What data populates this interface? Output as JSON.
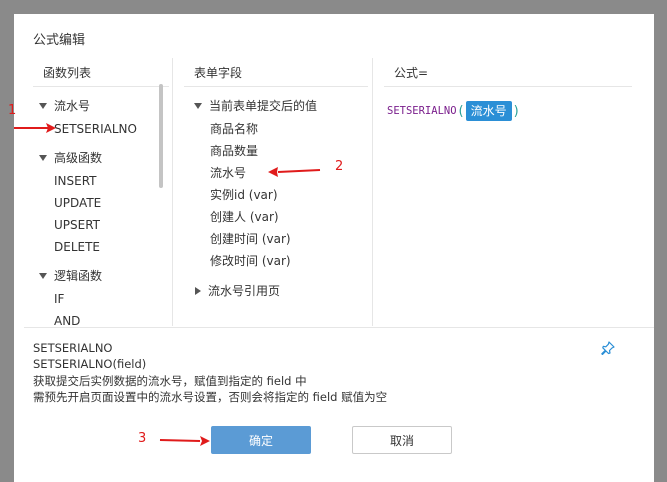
{
  "dialog": {
    "title": "公式编辑",
    "columns": {
      "functions": "函数列表",
      "fields": "表单字段",
      "formula": "公式="
    },
    "function_tree": [
      {
        "label": "流水号",
        "expanded": true
      },
      {
        "label": "SETSERIALNO"
      },
      {
        "label": "高级函数",
        "expanded": true
      },
      {
        "label": "INSERT"
      },
      {
        "label": "UPDATE"
      },
      {
        "label": "UPSERT"
      },
      {
        "label": "DELETE"
      },
      {
        "label": "逻辑函数",
        "expanded": true
      },
      {
        "label": "IF"
      },
      {
        "label": "AND"
      }
    ],
    "field_tree": [
      {
        "label": "当前表单提交后的值",
        "expanded": true
      },
      {
        "label": "商品名称"
      },
      {
        "label": "商品数量"
      },
      {
        "label": "流水号"
      },
      {
        "label": "实例id (var)"
      },
      {
        "label": "创建人 (var)"
      },
      {
        "label": "创建时间 (var)"
      },
      {
        "label": "修改时间 (var)"
      },
      {
        "label": "流水号引用页",
        "expanded": false
      }
    ],
    "formula": {
      "function_name": "SETSERIALNO",
      "open_paren": "(",
      "field_tag": "流水号",
      "close_paren": ")"
    },
    "description": [
      "SETSERIALNO",
      "SETSERIALNO(field)",
      "获取提交后实例数据的流水号，赋值到指定的 field 中",
      "需预先开启页面设置中的流水号设置，否则会将指定的 field 赋值为空"
    ],
    "buttons": {
      "ok": "确定",
      "cancel": "取消"
    },
    "icons": {
      "pin": "pin-icon"
    }
  },
  "annotations": {
    "marker_1": "1",
    "marker_2": "2",
    "marker_3": "3",
    "color": "#e01b1b"
  },
  "colors": {
    "accent": "#2b8fd6",
    "ok_button": "#5b9bd5",
    "formula_function": "#7a1e8c"
  }
}
